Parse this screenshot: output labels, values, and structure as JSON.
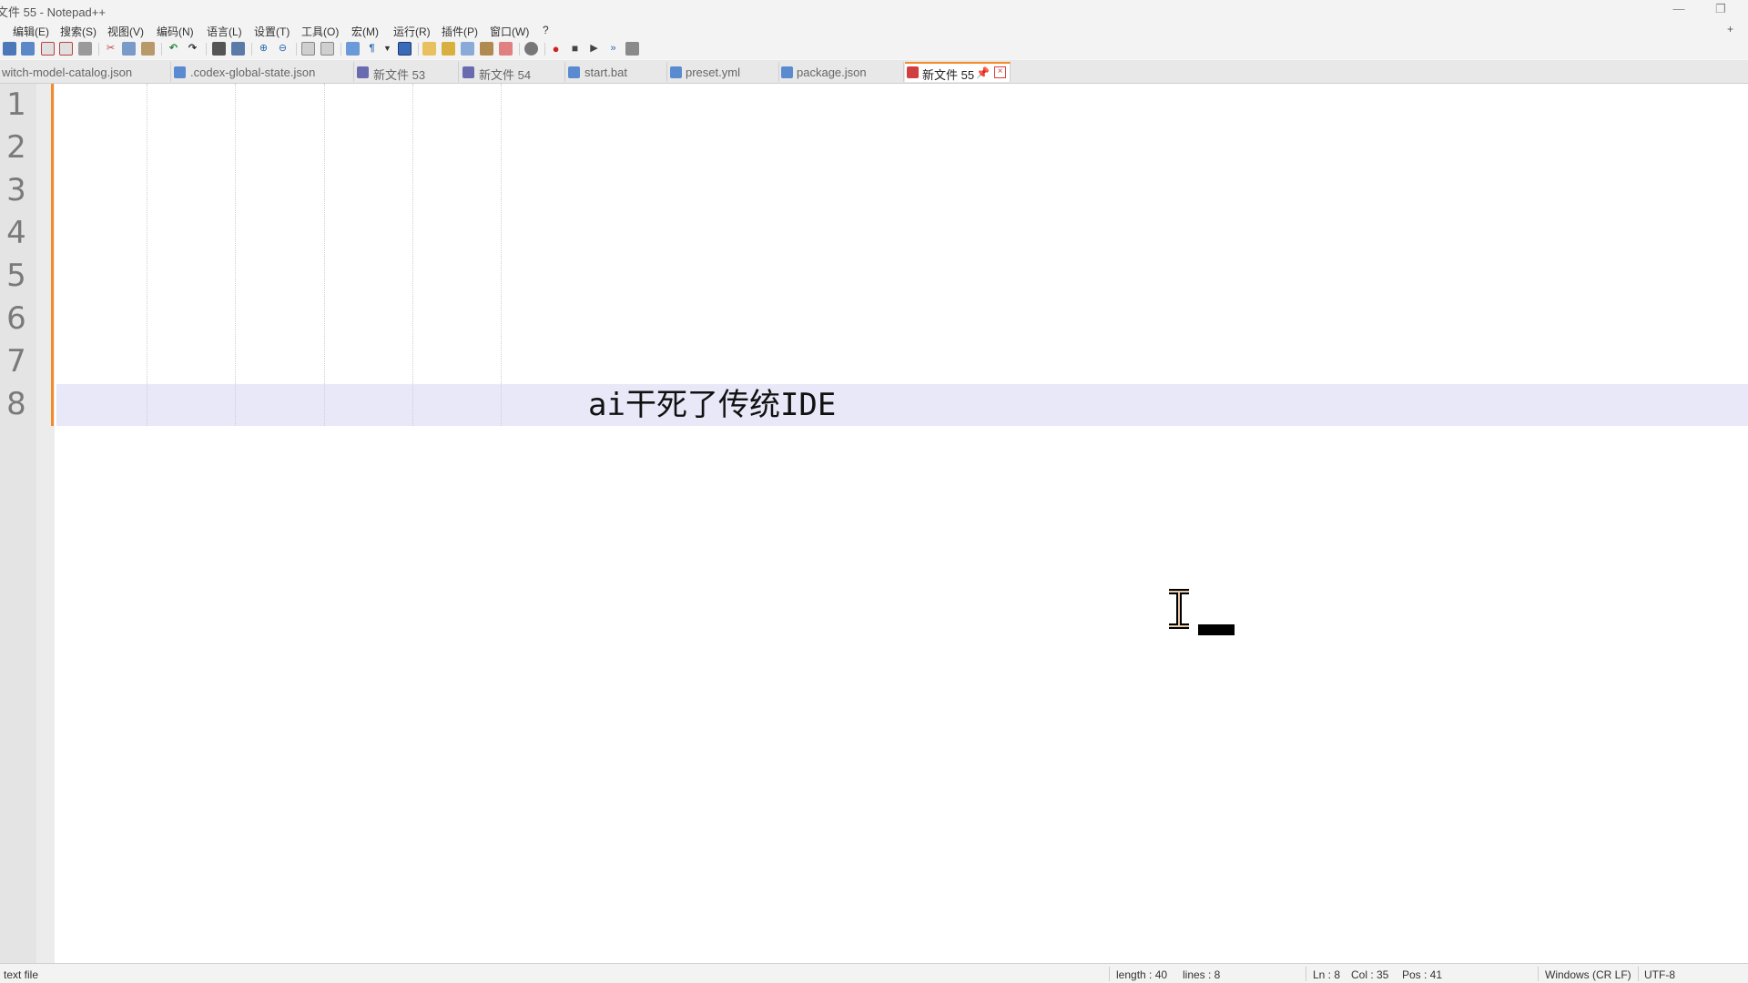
{
  "window": {
    "title": "文件 55 - Notepad++",
    "minimize_glyph": "—",
    "restore_glyph": "❐"
  },
  "menu": {
    "items": [
      "编辑(E)",
      "搜索(S)",
      "视图(V)",
      "编码(N)",
      "语言(L)",
      "设置(T)",
      "工具(O)",
      "宏(M)",
      "运行(R)",
      "插件(P)",
      "窗口(W)",
      "?"
    ],
    "plus_glyph": "+"
  },
  "toolbar": {
    "icons": [
      "save-icon",
      "save-all-icon",
      "close-icon",
      "close-all-icon",
      "print-icon",
      "cut-icon",
      "copy-icon",
      "paste-icon",
      "undo-icon",
      "redo-icon",
      "find-icon",
      "replace-icon",
      "zoom-in-icon",
      "zoom-out-icon",
      "sync-vertical-icon",
      "sync-horizontal-icon",
      "word-wrap-icon",
      "show-all-chars-icon",
      "indent-guide-icon",
      "user-lang-icon",
      "doc-map-icon",
      "function-list-icon",
      "folder-workspace-icon",
      "monitoring-icon",
      "start-recording-icon",
      "stop-recording-icon",
      "playback-icon",
      "run-multiple-icon",
      "save-macro-icon"
    ]
  },
  "tabs": [
    {
      "label": "witch-model-catalog.json",
      "active": false
    },
    {
      "label": ".codex-global-state.json",
      "active": false
    },
    {
      "label": "新文件 53",
      "active": false
    },
    {
      "label": "新文件 54",
      "active": false
    },
    {
      "label": "start.bat",
      "active": false
    },
    {
      "label": "preset.yml",
      "active": false
    },
    {
      "label": "package.json",
      "active": false
    },
    {
      "label": "新文件 55",
      "active": true
    }
  ],
  "editor": {
    "line_numbers": [
      "1",
      "2",
      "3",
      "4",
      "5",
      "6",
      "7",
      "8"
    ],
    "current_line_text": "ai干死了传统IDE"
  },
  "status": {
    "file_type": "text file",
    "length": "length : 40",
    "lines": "lines : 8",
    "ln": "Ln : 8",
    "col": "Col : 35",
    "pos": "Pos : 41",
    "eol": "Windows (CR LF)",
    "encoding": "UTF-8"
  },
  "colors": {
    "accent_tab": "#f28c28",
    "current_line": "#e8e8f8",
    "close_red": "#d04040"
  }
}
